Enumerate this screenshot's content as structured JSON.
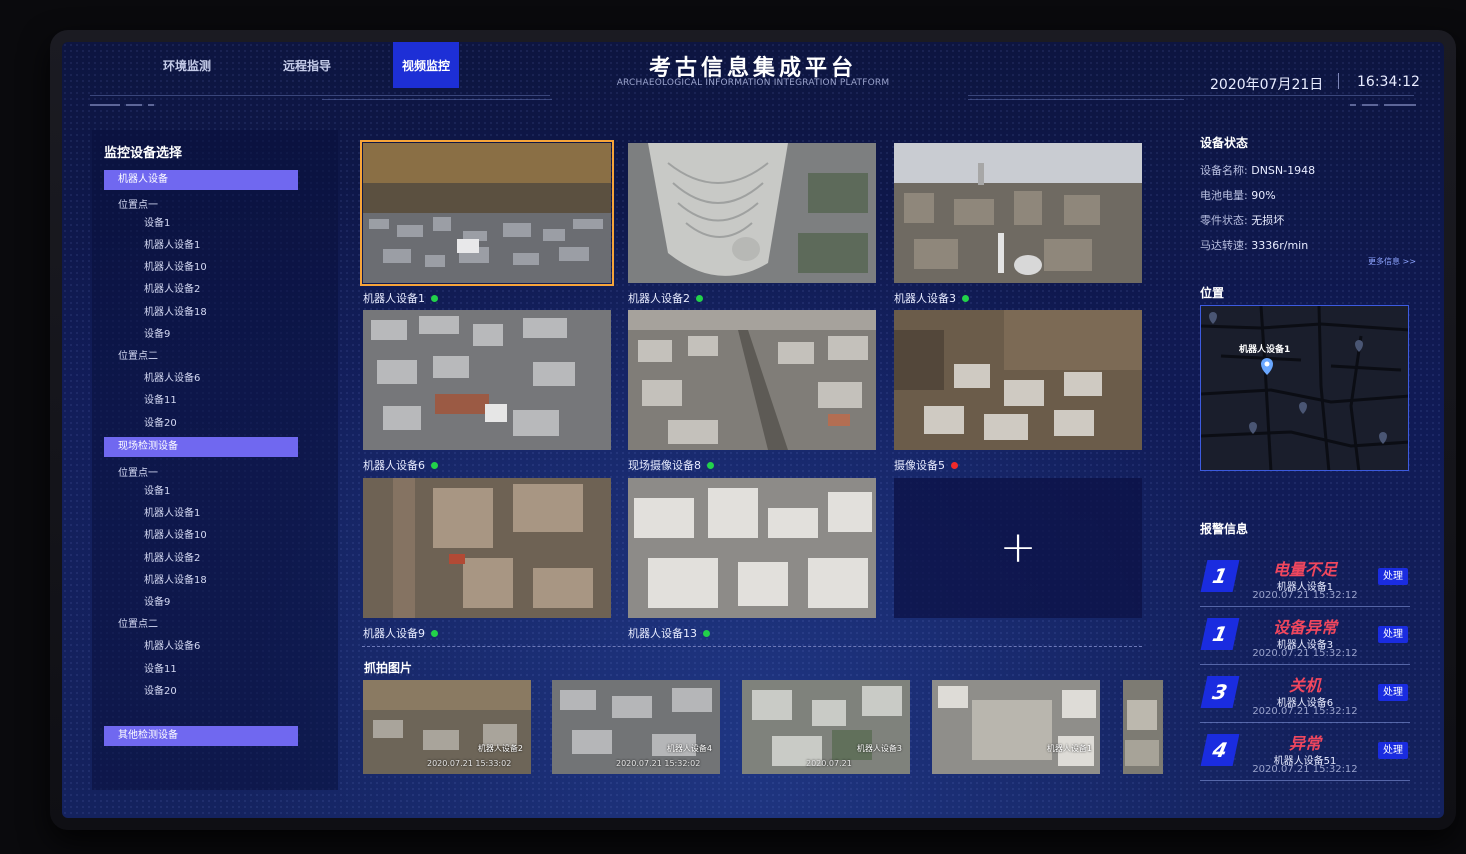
{
  "nav": {
    "tabs": [
      {
        "label": "环境监测"
      },
      {
        "label": "远程指导"
      },
      {
        "label": "视频监控"
      }
    ],
    "active_tab": "视频监控"
  },
  "header": {
    "title": "考古信息集成平台",
    "subtitle": "ARCHAEOLOGICAL INFORMATION INTEGRATION PLATFORM",
    "date": "2020年07月21日",
    "time": "16:34:12"
  },
  "left_panel": {
    "title": "监控设备选择",
    "groups": [
      {
        "label": "机器人设备",
        "locations": [
          {
            "label": "位置点一",
            "items": [
              "设备1",
              "机器人设备1",
              "机器人设备10",
              "机器人设备2",
              "机器人设备18",
              "设备9"
            ]
          },
          {
            "label": "位置点二",
            "items": [
              "机器人设备6",
              "设备11",
              "设备20"
            ]
          }
        ]
      },
      {
        "label": "现场检测设备",
        "locations": [
          {
            "label": "位置点一",
            "items": [
              "设备1",
              "机器人设备1",
              "机器人设备10",
              "机器人设备2",
              "机器人设备18",
              "设备9"
            ]
          },
          {
            "label": "位置点二",
            "items": [
              "机器人设备6",
              "设备11",
              "设备20"
            ]
          }
        ]
      },
      {
        "label": "其他检测设备",
        "locations": []
      }
    ]
  },
  "videos": [
    {
      "label": "机器人设备1",
      "status": "online"
    },
    {
      "label": "机器人设备2",
      "status": "online"
    },
    {
      "label": "机器人设备3",
      "status": "online"
    },
    {
      "label": "机器人设备6",
      "status": "online"
    },
    {
      "label": "现场摄像设备8",
      "status": "online"
    },
    {
      "label": "摄像设备5",
      "status": "offline"
    },
    {
      "label": "机器人设备9",
      "status": "online"
    },
    {
      "label": "机器人设备13",
      "status": "online"
    }
  ],
  "status_colors": {
    "online": "#22d24a",
    "offline": "#f02a2a"
  },
  "add_icon": "+",
  "snapshots": {
    "title": "抓拍图片",
    "items": [
      {
        "device": "机器人设备2",
        "time": "2020.07.21 15:33:02"
      },
      {
        "device": "机器人设备4",
        "time": "2020.07.21 15:32:02"
      },
      {
        "device": "机器人设备3",
        "time": "2020.07.21"
      },
      {
        "device": "机器人设备1",
        "time": ""
      }
    ]
  },
  "device_status": {
    "title": "设备状态",
    "rows": [
      {
        "key": "设备名称:",
        "value": "DNSN-1948"
      },
      {
        "key": "电池电量:",
        "value": "90%"
      },
      {
        "key": "零件状态:",
        "value": "无损坏"
      },
      {
        "key": "马达转速:",
        "value": "3336r/min"
      }
    ],
    "more_link": "更多信息 >>"
  },
  "location": {
    "title": "位置",
    "marker_label": "机器人设备1"
  },
  "alarms": {
    "title": "报警信息",
    "button_label": "处理",
    "items": [
      {
        "num": "1",
        "title": "电量不足",
        "device": "机器人设备1",
        "time": "2020.07.21  15:32:12"
      },
      {
        "num": "1",
        "title": "设备异常",
        "device": "机器人设备3",
        "time": "2020.07.21  15:32:12"
      },
      {
        "num": "3",
        "title": "关机",
        "device": "机器人设备6",
        "time": "2020.07.21  15:32:12"
      },
      {
        "num": "4",
        "title": "异常",
        "device": "机器人设备51",
        "time": "2020.07.21  15:32:12"
      }
    ]
  }
}
